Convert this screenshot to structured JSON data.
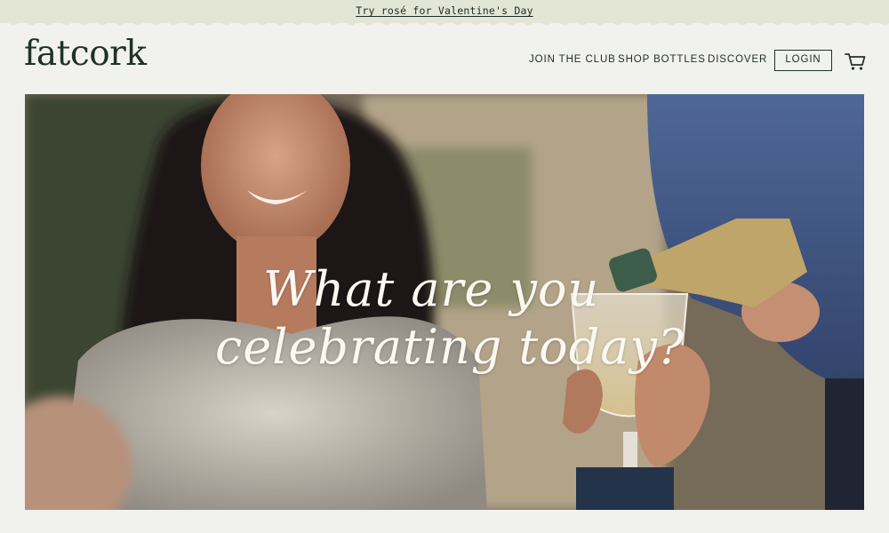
{
  "promo": {
    "text": "Try rosé for Valentine's Day"
  },
  "header": {
    "logo": "fatcork",
    "nav": {
      "join": "JOIN THE CLUB",
      "shop": "SHOP BOTTLES",
      "discover": "DISCOVER"
    },
    "login": "LOGIN",
    "cart_icon": "shopping-cart-icon"
  },
  "hero": {
    "headline_line1": "What are you",
    "headline_line2": "celebrating today?"
  },
  "colors": {
    "promo_bg": "#e3e6d5",
    "page_bg": "#f1f1ee",
    "text": "#1d2a24",
    "headline": "#fbf8f2"
  }
}
